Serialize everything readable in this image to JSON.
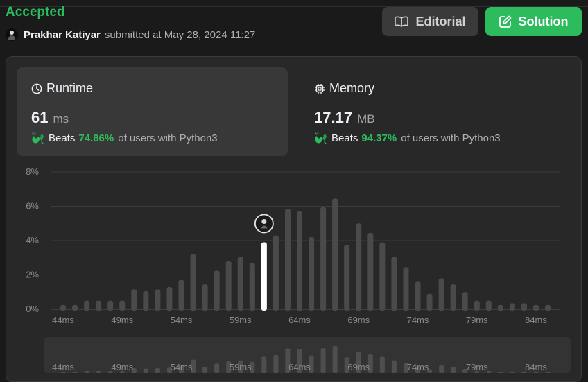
{
  "status": {
    "label": "Accepted",
    "color": "#2cbb5d"
  },
  "submission": {
    "user": "Prakhar Katiyar",
    "submitted_text": "submitted at May 28, 2024 11:27"
  },
  "buttons": {
    "editorial": "Editorial",
    "solution": "Solution"
  },
  "runtime": {
    "title": "Runtime",
    "value": "61",
    "unit": "ms",
    "beats_word": "Beats",
    "beats_pct": "74.86%",
    "beats_tail": "of users with Python3"
  },
  "memory": {
    "title": "Memory",
    "value": "17.17",
    "unit": "MB",
    "beats_word": "Beats",
    "beats_pct": "94.37%",
    "beats_tail": "of users with Python3"
  },
  "icons": {
    "clock": "clock-icon",
    "chip": "chip-icon",
    "book": "book-icon",
    "edit": "edit-icon",
    "hands": "clapping-hands-icon",
    "avatar": "avatar"
  },
  "chart_data": {
    "type": "bar",
    "x": [
      44,
      45,
      46,
      47,
      48,
      49,
      50,
      51,
      52,
      53,
      54,
      55,
      56,
      57,
      58,
      59,
      60,
      61,
      62,
      63,
      64,
      65,
      66,
      67,
      68,
      69,
      70,
      71,
      72,
      73,
      74,
      75,
      76,
      77,
      78,
      79,
      80,
      81,
      82,
      83,
      84,
      85
    ],
    "values": [
      0.25,
      0.25,
      0.5,
      0.5,
      0.5,
      0.5,
      1.15,
      1.05,
      1.15,
      1.3,
      1.7,
      3.2,
      1.45,
      2.25,
      2.8,
      3.05,
      2.7,
      3.9,
      4.3,
      5.85,
      5.7,
      4.2,
      5.95,
      6.45,
      3.75,
      5.0,
      4.45,
      3.9,
      3.05,
      2.45,
      1.6,
      0.9,
      1.8,
      1.45,
      1.0,
      0.5,
      0.5,
      0.25,
      0.35,
      0.35,
      0.25,
      0.25
    ],
    "highlight_x": 61,
    "highlight_color": "#ffffff",
    "bar_color": "#4a4a4a",
    "ylim": [
      0,
      8
    ],
    "yticks": [
      "0%",
      "2%",
      "4%",
      "6%",
      "8%"
    ],
    "xticks": [
      "44ms",
      "49ms",
      "54ms",
      "59ms",
      "64ms",
      "69ms",
      "74ms",
      "79ms",
      "84ms"
    ],
    "grid": true
  }
}
